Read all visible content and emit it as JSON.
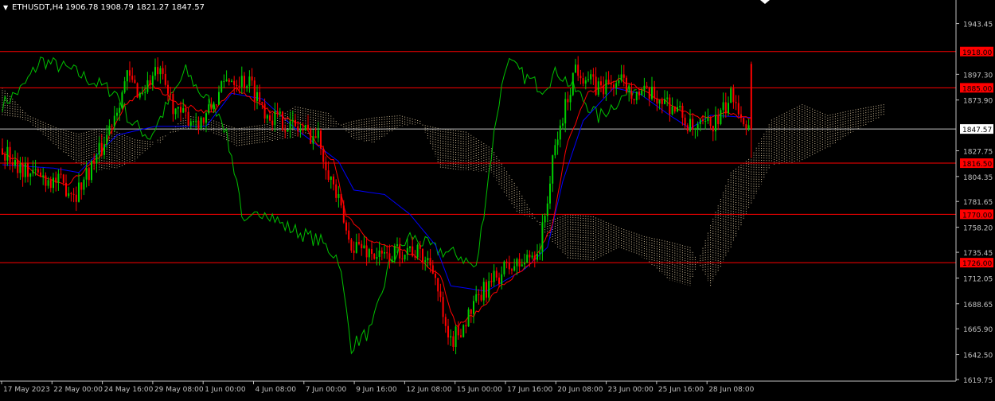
{
  "header": {
    "arrow_glyph": "▼",
    "symbol_tf": "ETHUSDT,H4",
    "ohlc": "1906.78 1908.79 1821.27 1847.57"
  },
  "colors": {
    "background": "#000000",
    "axis": "#c0c0c0",
    "bull": "#00d000",
    "bear": "#ff0000",
    "tenkan": "#ff0000",
    "kijun": "#0000ff",
    "chikou": "#00c000",
    "cloud": "#f5deb3",
    "hline": "#ff0000",
    "hline_label_bg": "#ff0000",
    "current_price_line": "#c0c0c0"
  },
  "chart_data": {
    "type": "candlestick",
    "title": "ETHUSDT,H4",
    "timeframe": "H4",
    "ohlc_last": {
      "open": 1906.78,
      "high": 1908.79,
      "low": 1821.27,
      "close": 1847.57
    },
    "y_axis": {
      "min": 1619.75,
      "max": 1954.0,
      "ticks": [
        "1943.45",
        "1897.30",
        "1873.90",
        "1827.75",
        "1804.35",
        "1781.65",
        "1758.20",
        "1735.45",
        "1712.05",
        "1688.65",
        "1665.90",
        "1642.50",
        "1619.75"
      ]
    },
    "x_ticks": [
      "17 May 2023",
      "22 May 00:00",
      "24 May 16:00",
      "29 May 08:00",
      "1 Jun 00:00",
      "4 Jun 08:00",
      "7 Jun 00:00",
      "9 Jun 16:00",
      "12 Jun 08:00",
      "15 Jun 00:00",
      "17 Jun 16:00",
      "20 Jun 08:00",
      "23 Jun 00:00",
      "25 Jun 16:00",
      "28 Jun 08:00"
    ],
    "horizontal_lines": [
      {
        "value": 1918.0,
        "label": "1918.00"
      },
      {
        "value": 1885.0,
        "label": "1885.00"
      },
      {
        "value": 1816.5,
        "label": "1816.50"
      },
      {
        "value": 1770.0,
        "label": "1770.00"
      },
      {
        "value": 1726.0,
        "label": "1726.00"
      }
    ],
    "current_price": {
      "value": 1847.57,
      "label": "1847.57"
    },
    "price_anchors": [
      [
        0,
        1830
      ],
      [
        10,
        1810
      ],
      [
        22,
        1800
      ],
      [
        30,
        1790
      ],
      [
        40,
        1830
      ],
      [
        50,
        1895
      ],
      [
        55,
        1880
      ],
      [
        62,
        1900
      ],
      [
        70,
        1860
      ],
      [
        80,
        1855
      ],
      [
        90,
        1895
      ],
      [
        98,
        1890
      ],
      [
        105,
        1862
      ],
      [
        115,
        1850
      ],
      [
        125,
        1840
      ],
      [
        133,
        1780
      ],
      [
        137,
        1745
      ],
      [
        142,
        1740
      ],
      [
        150,
        1730
      ],
      [
        160,
        1740
      ],
      [
        170,
        1725
      ],
      [
        176,
        1650
      ],
      [
        182,
        1670
      ],
      [
        190,
        1700
      ],
      [
        198,
        1720
      ],
      [
        205,
        1725
      ],
      [
        212,
        1740
      ],
      [
        218,
        1830
      ],
      [
        226,
        1905
      ],
      [
        234,
        1885
      ],
      [
        244,
        1890
      ],
      [
        250,
        1880
      ],
      [
        260,
        1875
      ],
      [
        266,
        1865
      ],
      [
        272,
        1845
      ],
      [
        282,
        1855
      ],
      [
        288,
        1880
      ],
      [
        294,
        1847
      ]
    ],
    "candle_count": 295,
    "ichimoku": {
      "tenkan_anchors": [
        [
          0,
          1828
        ],
        [
          12,
          1808
        ],
        [
          25,
          1795
        ],
        [
          38,
          1822
        ],
        [
          48,
          1868
        ],
        [
          58,
          1888
        ],
        [
          70,
          1870
        ],
        [
          82,
          1862
        ],
        [
          92,
          1885
        ],
        [
          104,
          1865
        ],
        [
          118,
          1850
        ],
        [
          130,
          1818
        ],
        [
          135,
          1770
        ],
        [
          145,
          1745
        ],
        [
          160,
          1735
        ],
        [
          172,
          1715
        ],
        [
          178,
          1668
        ],
        [
          186,
          1680
        ],
        [
          196,
          1705
        ],
        [
          208,
          1725
        ],
        [
          216,
          1760
        ],
        [
          222,
          1838
        ],
        [
          230,
          1880
        ],
        [
          242,
          1893
        ],
        [
          252,
          1882
        ],
        [
          264,
          1868
        ],
        [
          274,
          1858
        ],
        [
          284,
          1862
        ],
        [
          294,
          1856
        ]
      ],
      "kijun_anchors": [
        [
          0,
          1815
        ],
        [
          20,
          1812
        ],
        [
          30,
          1808
        ],
        [
          45,
          1842
        ],
        [
          60,
          1850
        ],
        [
          80,
          1850
        ],
        [
          90,
          1880
        ],
        [
          102,
          1875
        ],
        [
          115,
          1848
        ],
        [
          132,
          1818
        ],
        [
          138,
          1792
        ],
        [
          150,
          1788
        ],
        [
          160,
          1770
        ],
        [
          170,
          1742
        ],
        [
          176,
          1705
        ],
        [
          190,
          1700
        ],
        [
          205,
          1720
        ],
        [
          214,
          1740
        ],
        [
          220,
          1800
        ],
        [
          228,
          1855
        ],
        [
          240,
          1885
        ],
        [
          250,
          1880
        ],
        [
          262,
          1860
        ],
        [
          270,
          1848
        ],
        [
          278,
          1860
        ],
        [
          294,
          1858
        ]
      ],
      "chikou_anchors": [
        [
          0,
          1870
        ],
        [
          8,
          1885
        ],
        [
          15,
          1910
        ],
        [
          22,
          1905
        ],
        [
          28,
          1900
        ],
        [
          36,
          1890
        ],
        [
          45,
          1880
        ],
        [
          50,
          1855
        ],
        [
          58,
          1840
        ],
        [
          66,
          1875
        ],
        [
          72,
          1900
        ],
        [
          78,
          1880
        ],
        [
          86,
          1860
        ],
        [
          92,
          1802
        ],
        [
          95,
          1758
        ],
        [
          103,
          1775
        ],
        [
          110,
          1760
        ],
        [
          118,
          1752
        ],
        [
          125,
          1745
        ],
        [
          132,
          1730
        ],
        [
          137,
          1650
        ],
        [
          145,
          1665
        ],
        [
          152,
          1725
        ],
        [
          160,
          1750
        ],
        [
          170,
          1738
        ],
        [
          180,
          1732
        ],
        [
          186,
          1720
        ],
        [
          194,
          1860
        ],
        [
          198,
          1910
        ],
        [
          205,
          1895
        ],
        [
          212,
          1885
        ],
        [
          218,
          1900
        ],
        [
          226,
          1880
        ],
        [
          234,
          1858
        ],
        [
          240,
          1870
        ],
        [
          249,
          1886
        ]
      ],
      "span_a_anchors": [
        [
          0,
          1885
        ],
        [
          10,
          1860
        ],
        [
          22,
          1848
        ],
        [
          30,
          1843
        ],
        [
          38,
          1848
        ],
        [
          45,
          1845
        ],
        [
          52,
          1838
        ],
        [
          62,
          1835
        ],
        [
          72,
          1860
        ],
        [
          82,
          1856
        ],
        [
          92,
          1848
        ],
        [
          104,
          1852
        ],
        [
          115,
          1868
        ],
        [
          128,
          1862
        ],
        [
          138,
          1838
        ],
        [
          146,
          1835
        ],
        [
          156,
          1850
        ],
        [
          164,
          1852
        ],
        [
          172,
          1848
        ],
        [
          182,
          1845
        ],
        [
          192,
          1830
        ],
        [
          202,
          1795
        ],
        [
          212,
          1755
        ],
        [
          222,
          1730
        ],
        [
          232,
          1728
        ],
        [
          242,
          1740
        ],
        [
          252,
          1730
        ],
        [
          262,
          1710
        ],
        [
          270,
          1705
        ],
        [
          278,
          1760
        ],
        [
          286,
          1808
        ],
        [
          294,
          1822
        ],
        [
          302,
          1856
        ],
        [
          314,
          1870
        ],
        [
          324,
          1860
        ],
        [
          334,
          1865
        ],
        [
          346,
          1870
        ]
      ],
      "span_b_anchors": [
        [
          0,
          1860
        ],
        [
          10,
          1855
        ],
        [
          22,
          1830
        ],
        [
          30,
          1815
        ],
        [
          38,
          1810
        ],
        [
          45,
          1812
        ],
        [
          52,
          1818
        ],
        [
          62,
          1840
        ],
        [
          72,
          1848
        ],
        [
          82,
          1845
        ],
        [
          92,
          1832
        ],
        [
          104,
          1836
        ],
        [
          115,
          1840
        ],
        [
          128,
          1848
        ],
        [
          138,
          1855
        ],
        [
          146,
          1858
        ],
        [
          156,
          1860
        ],
        [
          164,
          1855
        ],
        [
          172,
          1812
        ],
        [
          182,
          1810
        ],
        [
          192,
          1808
        ],
        [
          202,
          1772
        ],
        [
          212,
          1762
        ],
        [
          222,
          1770
        ],
        [
          232,
          1768
        ],
        [
          242,
          1758
        ],
        [
          252,
          1750
        ],
        [
          262,
          1745
        ],
        [
          270,
          1740
        ],
        [
          278,
          1705
        ],
        [
          286,
          1740
        ],
        [
          294,
          1780
        ],
        [
          302,
          1815
        ],
        [
          314,
          1818
        ],
        [
          324,
          1830
        ],
        [
          334,
          1845
        ],
        [
          346,
          1860
        ]
      ]
    }
  }
}
